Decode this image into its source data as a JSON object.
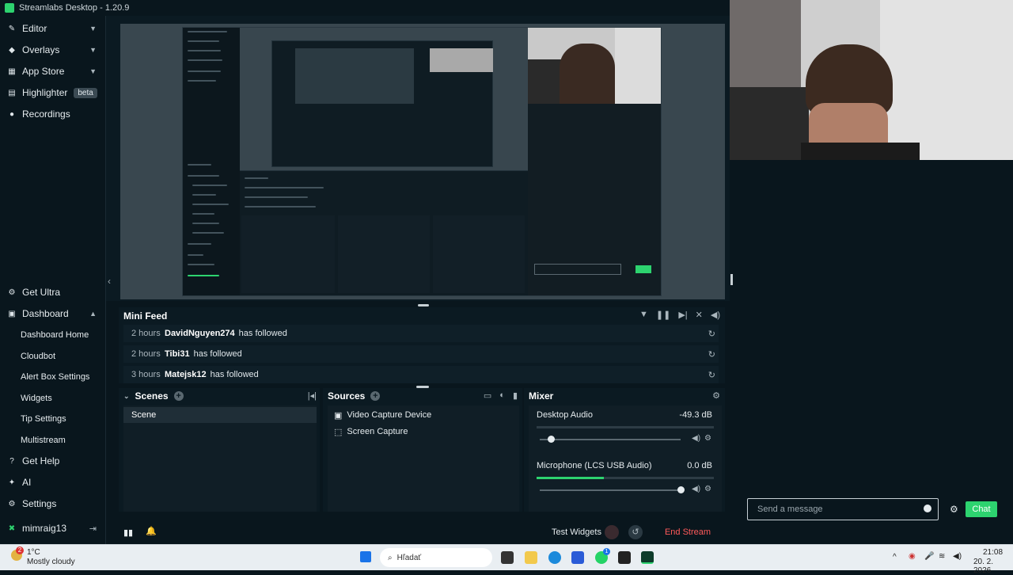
{
  "app": {
    "title": "Streamlabs Desktop - 1.20.9"
  },
  "sidebar": {
    "top_items": [
      {
        "label": "Editor",
        "icon": "pencil-icon",
        "expanded": false
      },
      {
        "label": "Overlays",
        "icon": "overlays-icon",
        "expanded": false
      },
      {
        "label": "App Store",
        "icon": "store-icon",
        "expanded": false
      },
      {
        "label": "Highlighter",
        "icon": "highlighter-icon",
        "badge": "beta"
      },
      {
        "label": "Recordings",
        "icon": "record-icon"
      }
    ],
    "bottom_items": {
      "get_ultra": "Get Ultra",
      "dashboard": "Dashboard",
      "dashboard_sub": [
        "Dashboard Home",
        "Cloudbot",
        "Alert Box Settings",
        "Widgets",
        "Tip Settings",
        "Multistream"
      ],
      "get_help": "Get Help",
      "ai": "AI",
      "settings": "Settings",
      "user": "mimraig13"
    }
  },
  "mini_feed": {
    "title": "Mini Feed",
    "rows": [
      {
        "time": "2 hours",
        "user": "DavidNguyen274",
        "action": "has followed"
      },
      {
        "time": "2 hours",
        "user": "Tibi31",
        "action": "has followed"
      },
      {
        "time": "3 hours",
        "user": "Matejsk12",
        "action": "has followed"
      }
    ]
  },
  "scenes": {
    "title": "Scenes",
    "items": [
      "Scene"
    ]
  },
  "sources": {
    "title": "Sources",
    "items": [
      {
        "label": "Video Capture Device",
        "icon": "camera-icon"
      },
      {
        "label": "Screen Capture",
        "icon": "screen-icon"
      }
    ]
  },
  "mixer": {
    "title": "Mixer",
    "channels": [
      {
        "label": "Desktop Audio",
        "db": "-49.3 dB",
        "level": 0.0,
        "volume": 0.08
      },
      {
        "label": "Microphone (LCS USB Audio)",
        "db": "0.0 dB",
        "level": 0.38,
        "volume": 1.0
      }
    ]
  },
  "footer": {
    "test_widgets": "Test Widgets",
    "end_stream": "End Stream"
  },
  "chat": {
    "placeholder": "Send a message",
    "button": "Chat"
  },
  "taskbar": {
    "weather_temp": "1°C",
    "weather_desc": "Mostly cloudy",
    "weather_badge": "2",
    "search_placeholder": "Hľadať",
    "time": "21:08",
    "date": "20. 2. 2026",
    "whatsapp_badge": "1"
  },
  "colors": {
    "accent": "#2dd36f",
    "end_stream": "#ff5a5a",
    "background": "#09161d"
  }
}
